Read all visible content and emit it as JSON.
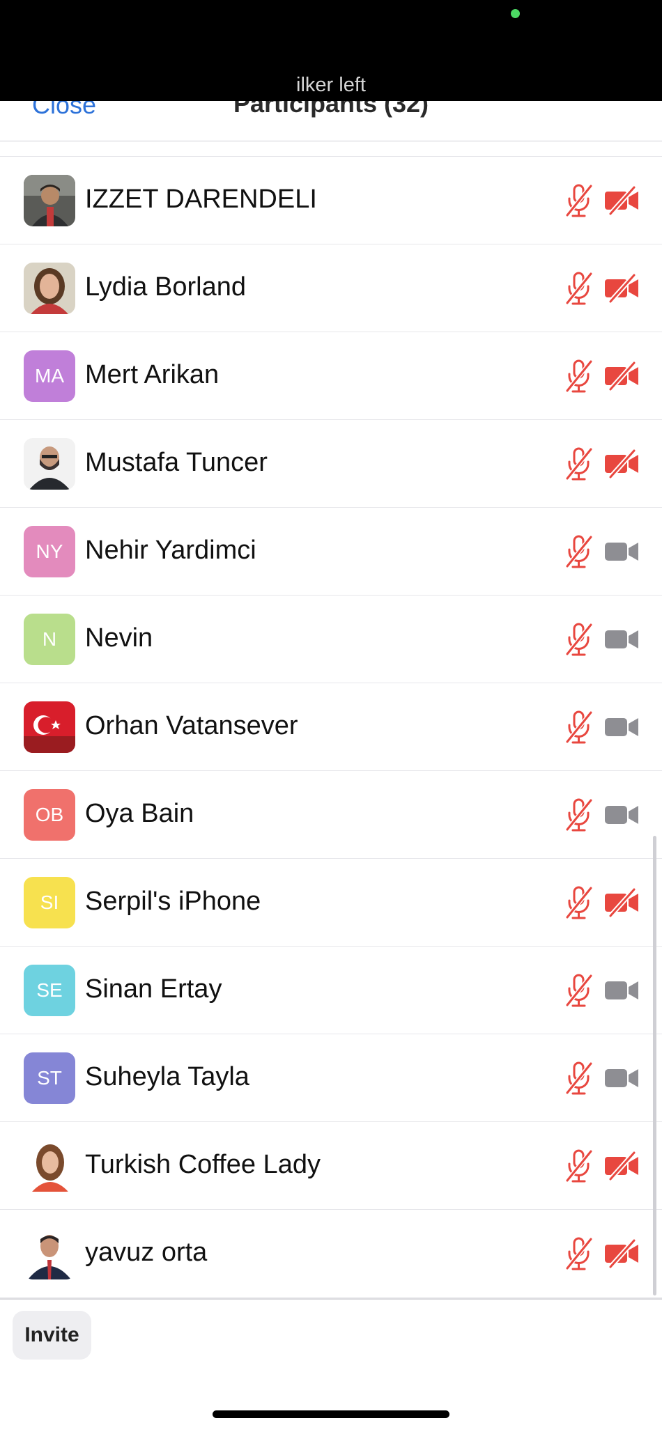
{
  "notification": {
    "text": "ilker left"
  },
  "header": {
    "close_label": "Close",
    "title": "Participants (32)"
  },
  "participants": [
    {
      "name": "IZZET DARENDELI",
      "avatar": {
        "type": "photo",
        "icon": "person-photo-avatar"
      },
      "audio": "muted",
      "video": "off"
    },
    {
      "name": "Lydia Borland",
      "avatar": {
        "type": "photo",
        "icon": "person-photo-avatar"
      },
      "audio": "muted",
      "video": "off"
    },
    {
      "name": "Mert Arikan",
      "avatar": {
        "type": "initials",
        "initials": "MA",
        "color": "#c07fd9"
      },
      "audio": "muted",
      "video": "off"
    },
    {
      "name": "Mustafa Tuncer",
      "avatar": {
        "type": "photo",
        "icon": "person-photo-avatar"
      },
      "audio": "muted",
      "video": "off"
    },
    {
      "name": "Nehir Yardimci",
      "avatar": {
        "type": "initials",
        "initials": "NY",
        "color": "#e38bbd"
      },
      "audio": "muted",
      "video": "on"
    },
    {
      "name": "Nevin",
      "avatar": {
        "type": "initials",
        "initials": "N",
        "color": "#b9de8c"
      },
      "audio": "muted",
      "video": "on"
    },
    {
      "name": "Orhan Vatansever",
      "avatar": {
        "type": "photo",
        "icon": "turkish-flag-avatar"
      },
      "audio": "muted",
      "video": "on"
    },
    {
      "name": "Oya Bain",
      "avatar": {
        "type": "initials",
        "initials": "OB",
        "color": "#f0716c"
      },
      "audio": "muted",
      "video": "on"
    },
    {
      "name": "Serpil's iPhone",
      "avatar": {
        "type": "initials",
        "initials": "SI",
        "color": "#f7e14f"
      },
      "audio": "muted",
      "video": "off"
    },
    {
      "name": "Sinan Ertay",
      "avatar": {
        "type": "initials",
        "initials": "SE",
        "color": "#6ed2e0"
      },
      "audio": "muted",
      "video": "on"
    },
    {
      "name": "Suheyla Tayla",
      "avatar": {
        "type": "initials",
        "initials": "ST",
        "color": "#8586d6"
      },
      "audio": "muted",
      "video": "on"
    },
    {
      "name": "Turkish Coffee Lady",
      "avatar": {
        "type": "photo",
        "icon": "person-photo-avatar"
      },
      "audio": "muted",
      "video": "off"
    },
    {
      "name": "yavuz orta",
      "avatar": {
        "type": "photo",
        "icon": "person-photo-avatar"
      },
      "audio": "muted",
      "video": "off"
    }
  ],
  "footer": {
    "invite_label": "Invite"
  },
  "colors": {
    "accent": "#2d72d9",
    "muted_red": "#e8473f",
    "video_on_gray": "#8e8e93"
  },
  "icons": {
    "mic": "mic-muted-icon",
    "video_off": "video-off-icon",
    "video_on": "video-camera-icon"
  }
}
